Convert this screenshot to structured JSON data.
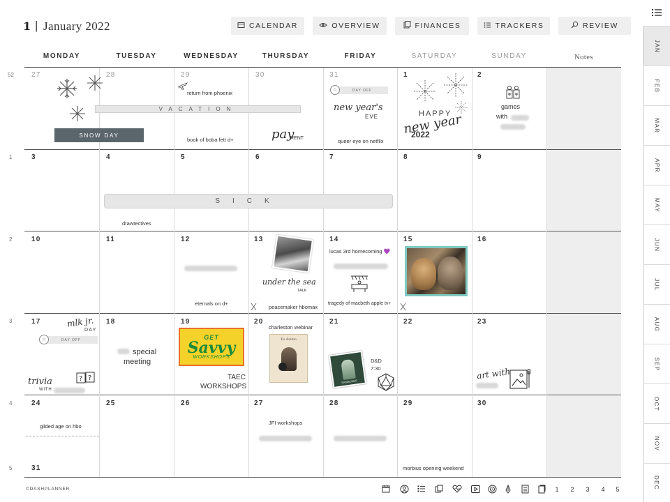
{
  "header": {
    "week_number": "1",
    "separator": "|",
    "month_title": "January 2022"
  },
  "nav": [
    {
      "label": "CALENDAR",
      "icon": "calendar-icon"
    },
    {
      "label": "OVERVIEW",
      "icon": "eye-icon"
    },
    {
      "label": "FINANCES",
      "icon": "finances-icon"
    },
    {
      "label": "TRACKERS",
      "icon": "checklist-icon"
    },
    {
      "label": "REVIEW",
      "icon": "magnifier-icon"
    }
  ],
  "day_headers": [
    "MONDAY",
    "TUESDAY",
    "WEDNESDAY",
    "THURSDAY",
    "FRIDAY",
    "SATURDAY",
    "SUNDAY"
  ],
  "notes_header": "Notes",
  "week_numbers": [
    "52",
    "1",
    "2",
    "3",
    "4",
    "5"
  ],
  "weeks": [
    [
      "27",
      "28",
      "29",
      "30",
      "31",
      "1",
      "2"
    ],
    [
      "3",
      "4",
      "5",
      "6",
      "7",
      "8",
      "9"
    ],
    [
      "10",
      "11",
      "12",
      "13",
      "14",
      "15",
      "16"
    ],
    [
      "17",
      "18",
      "19",
      "20",
      "21",
      "22",
      "23"
    ],
    [
      "24",
      "25",
      "26",
      "27",
      "28",
      "29",
      "30"
    ],
    [
      "31"
    ]
  ],
  "events": {
    "snow_day": "SNOW DAY",
    "vacation": "VACATION",
    "return_phoenix": "return from phoenix",
    "boba_fett": "book of boba fett d+",
    "pay": "pay",
    "rent": "RENT",
    "day_off_nye": "DAY OFF",
    "new_years_eve_1": "new year's",
    "new_years_eve_2": "EVE",
    "queer_eye": "queer eye on netflix",
    "happy": "HAPPY",
    "new_year": "new year",
    "year_2022": "2022",
    "games": "games",
    "with": "with",
    "sick": "SICK",
    "drawtectives": "drawtectives",
    "eternals": "eternals on d+",
    "under_the_sea": "under the sea",
    "talk": "TALK",
    "peacemaker": "peacemaker hbomax",
    "lucas": "lucas 3rd homecoming 💜",
    "macbeth": "tragedy of macbeth apple tv+",
    "mlk": "mlk jr.",
    "mlk_day": "DAY",
    "day_off_mlk": "DAY OFF",
    "trivia": "trivia",
    "trivia_with": "WITH",
    "special": "special",
    "meeting": "meeting",
    "get": "GET",
    "savvy": "Savvy",
    "workshops_logo": "WORKSHOPS",
    "taec": "TAEC",
    "taec_workshops": "WORKSHOPS",
    "charleston": "charleston webinar",
    "webinar_title": "Ex Animo",
    "dnd": "D&D",
    "dnd_time": "7:30",
    "dnd_card_caption": "SAMBONES",
    "art_with": "art with",
    "gilded_age": "gilded age on hbo",
    "jfi": "JFI workshops",
    "morbius": "morbius opening weekend"
  },
  "months": [
    "JAN",
    "FEB",
    "MAR",
    "APR",
    "MAY",
    "JUN",
    "JUL",
    "AUG",
    "SEP",
    "OCT",
    "NOV",
    "DEC"
  ],
  "active_month": "JAN",
  "footer": {
    "brand": "©DASHPLANNER",
    "icons": [
      "calendar-icon",
      "user-icon",
      "checklist-icon",
      "finances-icon",
      "heartbeat-icon",
      "play-icon",
      "target-icon",
      "pen-icon",
      "notebook-icon",
      "pages-icon"
    ],
    "page_numbers": [
      "1",
      "2",
      "3",
      "4",
      "5"
    ]
  }
}
